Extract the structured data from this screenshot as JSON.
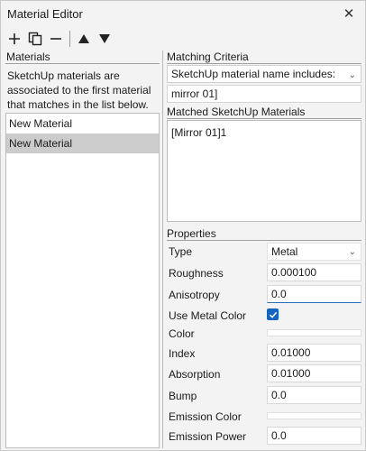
{
  "window": {
    "title": "Material Editor",
    "close_glyph": "✕"
  },
  "toolbar": {
    "icons": [
      "plus-icon",
      "duplicate-icon",
      "minus-icon",
      "arrow-up-icon",
      "arrow-down-icon"
    ],
    "plus": "+",
    "minus": "—",
    "up": "▲",
    "down": "▼"
  },
  "materials": {
    "heading": "Materials",
    "description": "SketchUp materials are associated to the first material that matches in the list below.",
    "items": [
      {
        "label": "New Material",
        "selected": false
      },
      {
        "label": "New Material",
        "selected": true
      }
    ]
  },
  "matching": {
    "heading": "Matching Criteria",
    "criterion": "SketchUp material name includes:",
    "value": "mirror 01]"
  },
  "matched": {
    "heading": "Matched SketchUp Materials",
    "items": [
      "[Mirror 01]1"
    ]
  },
  "properties": {
    "heading": "Properties",
    "type_label": "Type",
    "type_value": "Metal",
    "roughness_label": "Roughness",
    "roughness_value": "0.000100",
    "anisotropy_label": "Anisotropy",
    "anisotropy_value": "0.0",
    "use_metal_color_label": "Use Metal Color",
    "use_metal_color_checked": true,
    "color_label": "Color",
    "index_label": "Index",
    "index_value": "0.01000",
    "absorption_label": "Absorption",
    "absorption_value": "0.01000",
    "bump_label": "Bump",
    "bump_value": "0.0",
    "emission_color_label": "Emission Color",
    "emission_power_label": "Emission Power",
    "emission_power_value": "0.0"
  },
  "colors": {
    "accent": "#1565c0",
    "selection": "#cccccc"
  }
}
